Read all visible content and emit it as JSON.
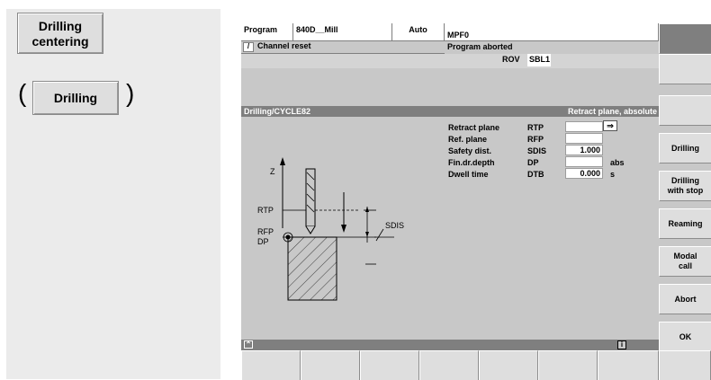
{
  "left_panel": {
    "drilling_centering_label": "Drilling\ncentering",
    "drilling_label": "Drilling",
    "paren_open": "(",
    "paren_close": ")"
  },
  "header": {
    "program_label": "Program",
    "program_name": "840D__Mill",
    "mode": "Auto",
    "file": "MPF0",
    "channel_status": "Channel reset",
    "program_status": "Program aborted",
    "flag_rov": "ROV",
    "flag_sbl": "SBL1"
  },
  "dialog": {
    "title": "Drilling/CYCLE82",
    "hint": "Retract plane, absolute"
  },
  "params": [
    {
      "label": "Retract plane",
      "code": "RTP",
      "value": "",
      "unit": ""
    },
    {
      "label": "Ref. plane",
      "code": "RFP",
      "value": "",
      "unit": ""
    },
    {
      "label": "Safety dist.",
      "code": "SDIS",
      "value": "1.000",
      "unit": ""
    },
    {
      "label": "Fin.dr.depth",
      "code": "DP",
      "value": "",
      "unit": "abs"
    },
    {
      "label": "Dwell time",
      "code": "DTB",
      "value": "0.000",
      "unit": "s"
    }
  ],
  "diagram": {
    "z": "Z",
    "rtp": "RTP",
    "rfp": "RFP",
    "dp": "DP",
    "sdis": "SDIS"
  },
  "softkeys": {
    "drilling": "Drilling",
    "drilling_with_stop": "Drilling\nwith stop",
    "reaming": "Reaming",
    "modal_call": "Modal\ncall",
    "abort": "Abort",
    "ok": "OK"
  },
  "footer": {
    "info": "i"
  },
  "colors": {
    "screen_bg": "#c8c8c8",
    "title_bar": "#7f7f7f",
    "panel_bg": "#ebebeb"
  }
}
